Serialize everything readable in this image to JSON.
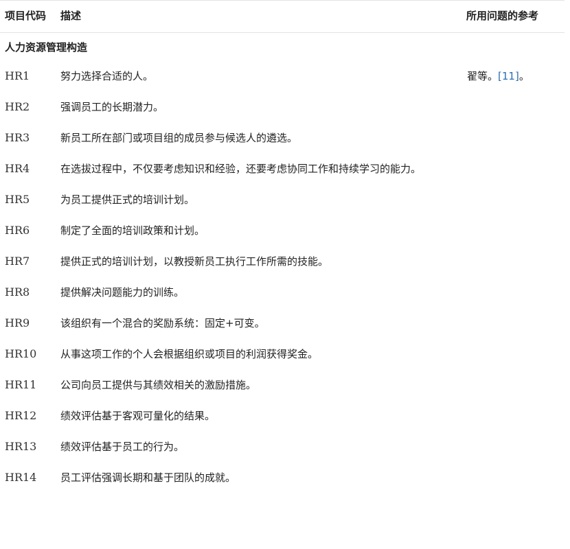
{
  "headers": {
    "code": "项目代码",
    "description": "描述",
    "reference": "所用问题的参考"
  },
  "section": {
    "title": "人力资源管理构造"
  },
  "reference": {
    "prefix": "翟等。",
    "cite": "[11]",
    "suffix": "。"
  },
  "rows": [
    {
      "code": "HR1",
      "desc": "努力选择合适的人。"
    },
    {
      "code": "HR2",
      "desc": "强调员工的长期潜力。"
    },
    {
      "code": "HR3",
      "desc": "新员工所在部门或项目组的成员参与候选人的遴选。"
    },
    {
      "code": "HR4",
      "desc": "在选拔过程中，不仅要考虑知识和经验，还要考虑协同工作和持续学习的能力。"
    },
    {
      "code": "HR5",
      "desc": "为员工提供正式的培训计划。"
    },
    {
      "code": "HR6",
      "desc": "制定了全面的培训政策和计划。"
    },
    {
      "code": "HR7",
      "desc": "提供正式的培训计划，以教授新员工执行工作所需的技能。"
    },
    {
      "code": "HR8",
      "desc": "提供解决问题能力的训练。"
    },
    {
      "code": "HR9",
      "desc": "该组织有一个混合的奖励系统：固定+可变。"
    },
    {
      "code": "HR10",
      "desc": "从事这项工作的个人会根据组织或项目的利润获得奖金。"
    },
    {
      "code": "HR11",
      "desc": "公司向员工提供与其绩效相关的激励措施。"
    },
    {
      "code": "HR12",
      "desc": "绩效评估基于客观可量化的结果。"
    },
    {
      "code": "HR13",
      "desc": "绩效评估基于员工的行为。"
    },
    {
      "code": "HR14",
      "desc": "员工评估强调长期和基于团队的成就。"
    }
  ]
}
